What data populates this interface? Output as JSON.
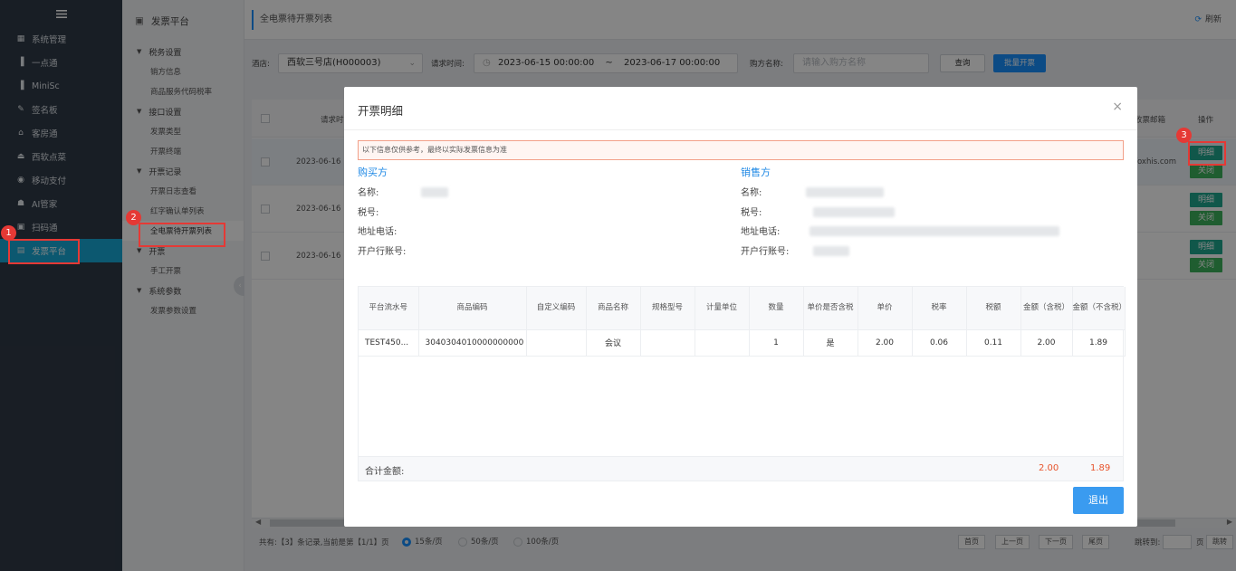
{
  "nav": {
    "items": [
      {
        "label": "系统管理",
        "icon": "grid-icon"
      },
      {
        "label": "一点通",
        "icon": "bar-chart-icon"
      },
      {
        "label": "MiniSc",
        "icon": "bar-chart-icon"
      },
      {
        "label": "签名板",
        "icon": "pen-icon"
      },
      {
        "label": "客房通",
        "icon": "home-icon"
      },
      {
        "label": "西软点菜",
        "icon": "eject-icon"
      },
      {
        "label": "移动支付",
        "icon": "globe-icon"
      },
      {
        "label": "AI管家",
        "icon": "robot-icon"
      },
      {
        "label": "扫码通",
        "icon": "qr-icon"
      },
      {
        "label": "发票平台",
        "icon": "invoice-icon"
      }
    ]
  },
  "submenu": {
    "title": "发票平台",
    "groups": [
      {
        "label": "税务设置",
        "links": [
          "销方信息",
          "商品服务代码税率"
        ]
      },
      {
        "label": "接口设置",
        "links": [
          "发票类型",
          "开票终端"
        ]
      },
      {
        "label": "开票记录",
        "links": [
          "开票日志查看",
          "红字确认单列表",
          "全电票待开票列表"
        ]
      },
      {
        "label": "开票",
        "links": [
          "手工开票"
        ]
      },
      {
        "label": "系统参数",
        "links": [
          "发票参数设置"
        ]
      }
    ]
  },
  "header": {
    "breadcrumb": "全电票待开票列表",
    "refresh": "刷新"
  },
  "filter": {
    "hotel_label": "酒店:",
    "hotel_value": "西软三号店(H000003)",
    "time_label": "请求时间:",
    "start": "2023-06-15 00:00:00",
    "sep": "~",
    "end": "2023-06-17 00:00:00",
    "buyer_label": "购方名称:",
    "buyer_placeholder": "请输入购方名称",
    "query": "查询",
    "batch": "批量开票"
  },
  "grid": {
    "col_request_time": "请求时",
    "col_email": "收票邮箱",
    "col_action": "操作",
    "rows": [
      {
        "time": "2023-06-16",
        "email": "foxhis.com"
      },
      {
        "time": "2023-06-16",
        "email": ""
      },
      {
        "time": "2023-06-16",
        "email": ""
      }
    ],
    "btn_detail": "明细",
    "btn_close": "关闭"
  },
  "pager": {
    "summary": "共有:【3】条记录,当前是第【1/1】页",
    "sizes": [
      "15条/页",
      "50条/页",
      "100条/页"
    ],
    "first": "首页",
    "prev": "上一页",
    "next": "下一页",
    "last": "尾页",
    "jump_label": "跳转到:",
    "page_unit": "页",
    "jump": "跳转"
  },
  "modal": {
    "title": "开票明细",
    "notice": "以下信息仅供参考，最终以实际发票信息为准",
    "buyer": {
      "title": "购买方",
      "name": "名称:",
      "tax": "税号:",
      "addr": "地址电话:",
      "bank": "开户行账号:"
    },
    "seller": {
      "title": "销售方",
      "name": "名称:",
      "tax": "税号:",
      "addr": "地址电话:",
      "bank": "开户行账号:"
    },
    "headers": [
      "平台流水号",
      "商品编码",
      "自定义编码",
      "商品名称",
      "规格型号",
      "计量单位",
      "数量",
      "单价是否含税",
      "单价",
      "税率",
      "税额",
      "金额（含税）",
      "金额（不含税）"
    ],
    "rows": [
      [
        "TEST450...",
        "3040304010000000000",
        "",
        "会议",
        "",
        "",
        "1",
        "是",
        "2.00",
        "0.06",
        "0.11",
        "2.00",
        "1.89"
      ]
    ],
    "total_label": "合计金额:",
    "total_with_tax": "2.00",
    "total_without_tax": "1.89",
    "exit": "退出"
  },
  "annotations": [
    "1",
    "2",
    "3"
  ]
}
